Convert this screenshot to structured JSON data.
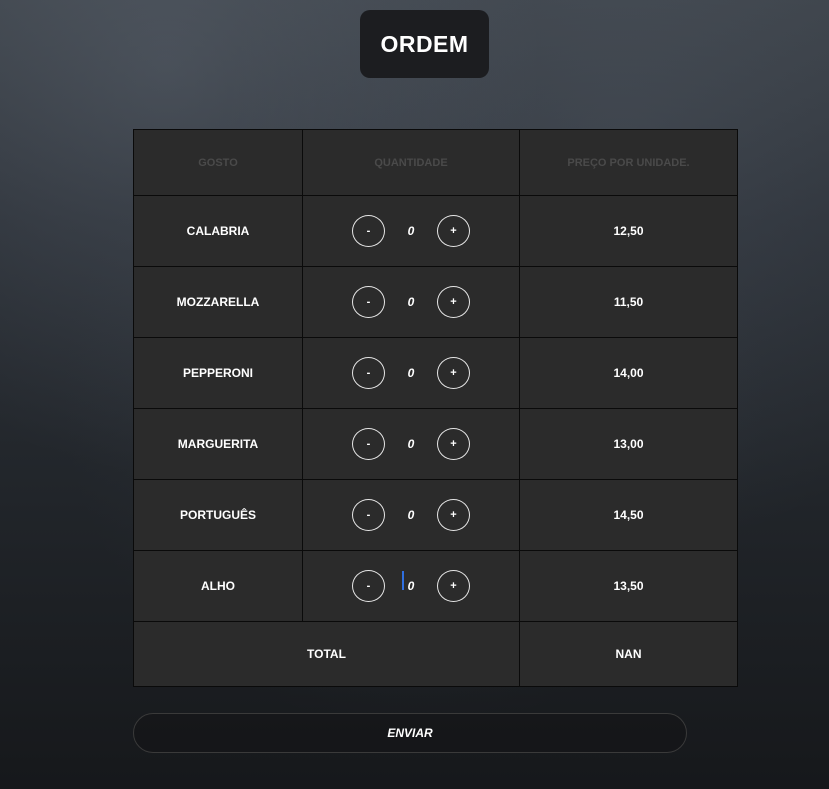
{
  "title": "ORDEM",
  "table": {
    "headers": [
      "GOSTO",
      "QUANTIDADE",
      "PREÇO POR UNIDADE."
    ],
    "rows": [
      {
        "flavor": "CALABRIA",
        "minus": "-",
        "quantity": "0",
        "plus": "+",
        "price": "12,50"
      },
      {
        "flavor": "MOZZARELLA",
        "minus": "-",
        "quantity": "0",
        "plus": "+",
        "price": "11,50"
      },
      {
        "flavor": "PEPPERONI",
        "minus": "-",
        "quantity": "0",
        "plus": "+",
        "price": "14,00"
      },
      {
        "flavor": "MARGUERITA",
        "minus": "-",
        "quantity": "0",
        "plus": "+",
        "price": "13,00"
      },
      {
        "flavor": "PORTUGUÊS",
        "minus": "-",
        "quantity": "0",
        "plus": "+",
        "price": "14,50"
      },
      {
        "flavor": "ALHO",
        "minus": "-",
        "quantity": "0",
        "plus": "+",
        "price": "13,50"
      }
    ],
    "total_label": "TOTAL",
    "total_value": "NAN"
  },
  "submit_label": "ENVIAR",
  "colors": {
    "cell_background": "#2b2b2b",
    "border": "#0a0a0a",
    "header_text": "#4a4a4a",
    "text": "#ffffff",
    "focus_cursor": "#2f6fe0"
  }
}
